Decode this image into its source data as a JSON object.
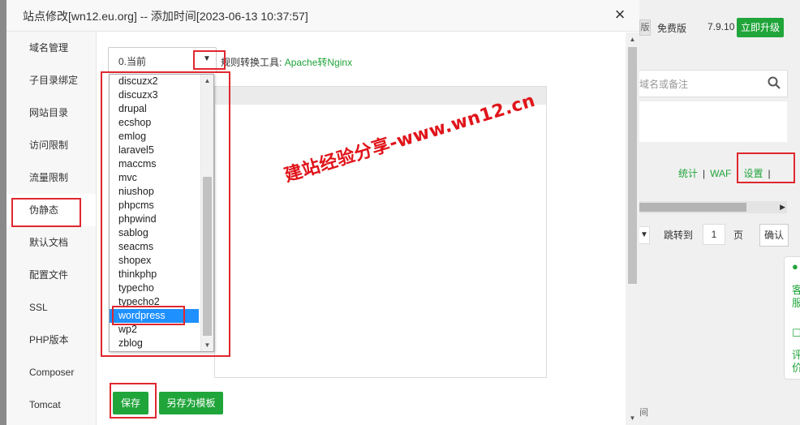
{
  "background": {
    "version_badge": "版",
    "free_label": "免费版",
    "version": "7.9.10",
    "upgrade_button": "立即升级",
    "search_placeholder": "域名或备注",
    "links": [
      "统计",
      "WAF",
      "设置"
    ],
    "jump_label": "跳转到",
    "page_value": "1",
    "page_unit": "页",
    "confirm_button": "确认",
    "side_panel_chars": [
      "客",
      "服",
      "评",
      "价"
    ],
    "bottom_text": "间"
  },
  "dialog": {
    "title": "站点修改[wn12.eu.org] -- 添加时间[2023-06-13 10:37:57]",
    "close_glyph": "×",
    "nav": [
      "域名管理",
      "子目录绑定",
      "网站目录",
      "访问限制",
      "流量限制",
      "伪静态",
      "默认文档",
      "配置文件",
      "SSL",
      "PHP版本",
      "Composer",
      "Tomcat"
    ],
    "active_nav_index": 5
  },
  "rewrite": {
    "select_value": "0.当前",
    "converter_label": "规则转换工具:",
    "converter_link": "Apache转Nginx",
    "options": [
      "discuzx2",
      "discuzx3",
      "drupal",
      "ecshop",
      "emlog",
      "laravel5",
      "maccms",
      "mvc",
      "niushop",
      "phpcms",
      "phpwind",
      "sablog",
      "seacms",
      "shopex",
      "thinkphp",
      "typecho",
      "typecho2",
      "wordpress",
      "wp2",
      "zblog"
    ],
    "selected_option": "wordpress",
    "save_button": "保存",
    "save_template_button": "另存为模板"
  },
  "watermark": "建站经验分享-www.wn12.cn",
  "colors": {
    "accent_green": "#20a53a",
    "highlight_red": "#e0272f",
    "selection_blue": "#1e90ff"
  }
}
